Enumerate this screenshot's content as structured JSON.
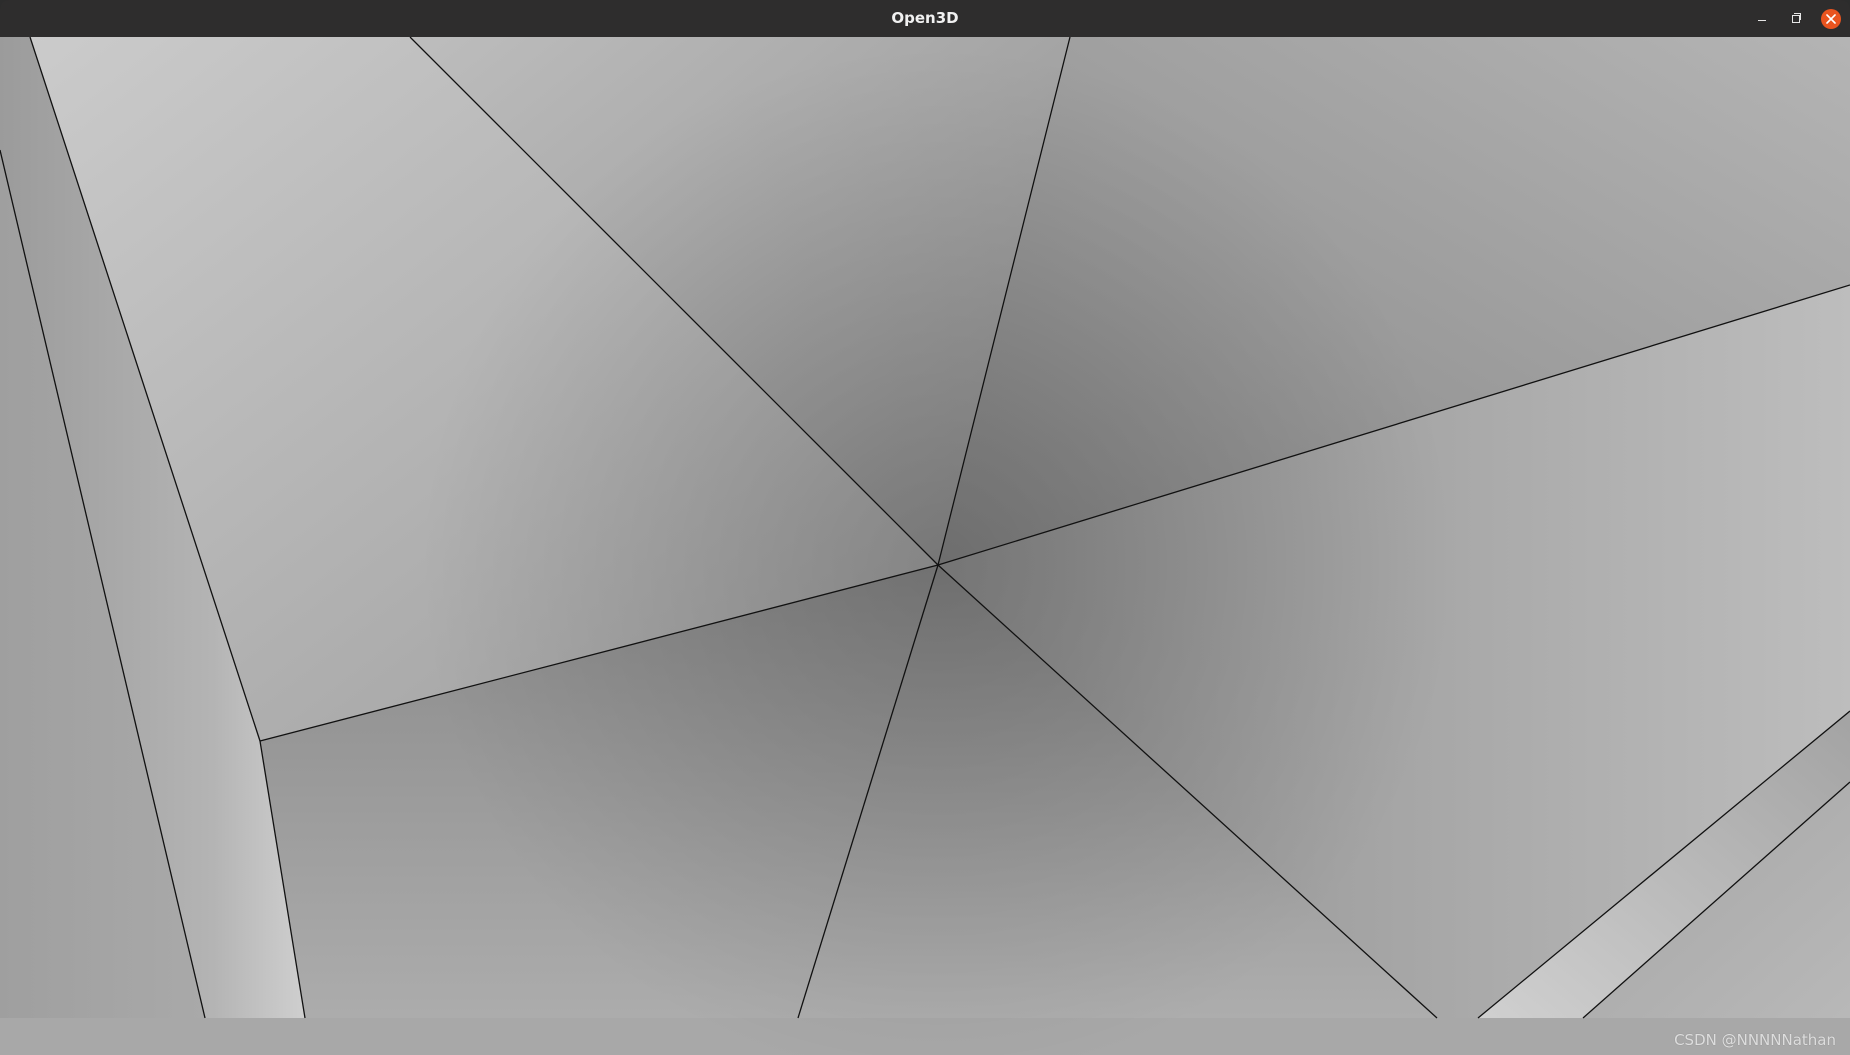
{
  "window": {
    "title": "Open3D",
    "controls": {
      "minimize_icon": "minimize-icon",
      "maximize_icon": "restore-icon",
      "close_icon": "close-icon",
      "close_color": "#e9541f"
    }
  },
  "viewport": {
    "watermark": "CSDN @NNNNNathan"
  }
}
